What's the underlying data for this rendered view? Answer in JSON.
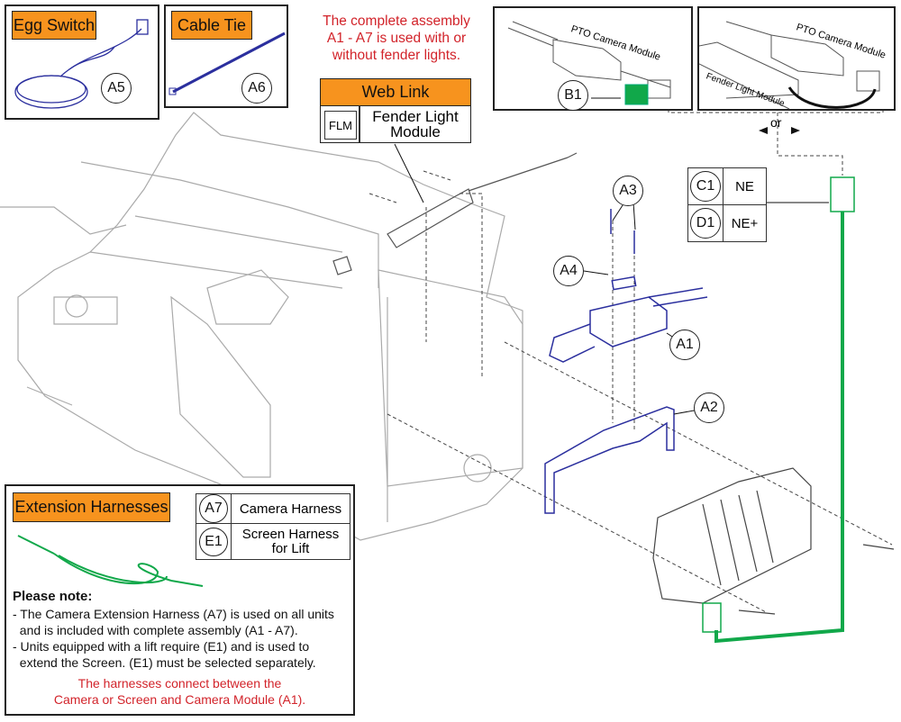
{
  "top_note": [
    "The complete assembly",
    "A1 - A7 is used with or",
    "without fender lights."
  ],
  "insets": {
    "egg_switch": {
      "title": "Egg Switch",
      "callout": "A5"
    },
    "cable_tie": {
      "title": "Cable Tie",
      "callout": "A6"
    },
    "pto_only": {
      "label": "PTO Camera Module",
      "callout": "B1"
    },
    "pto_fender": {
      "label": "PTO Camera Module",
      "fender_label": "Fender Light Module"
    },
    "or_label": "or"
  },
  "web_link": {
    "title": "Web Link",
    "code": "FLM",
    "description": [
      "Fender Light",
      "Module"
    ]
  },
  "ne_table": [
    {
      "callout": "C1",
      "label": "NE"
    },
    {
      "callout": "D1",
      "label": "NE+"
    }
  ],
  "callouts": {
    "a1": "A1",
    "a2": "A2",
    "a3": "A3",
    "a4": "A4"
  },
  "extension": {
    "title": "Extension Harnesses",
    "table": [
      {
        "callout": "A7",
        "label": "Camera Harness"
      },
      {
        "callout": "E1",
        "label": "Screen Harness for Lift"
      }
    ],
    "note_heading": "Please note:",
    "notes": [
      "- The Camera Extension Harness (A7) is used on all units",
      "  and is included with complete assembly (A1 - A7).",
      "- Units equipped with a lift require (E1) and is used to",
      "  extend the Screen. (E1) must be selected separately."
    ],
    "red_note": [
      "The harnesses connect between the",
      "Camera or Screen and Camera Module (A1)."
    ]
  },
  "colors": {
    "accent_orange": "#f7931e",
    "part_blue": "#2b2f9e",
    "harness_green": "#11a84a",
    "note_red": "#d2232a"
  }
}
